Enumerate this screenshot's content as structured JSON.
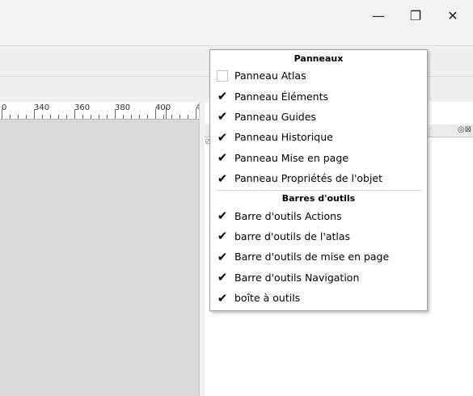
{
  "window": {
    "controls": {
      "minimize": "—",
      "maximize": "❐",
      "close": "✕"
    }
  },
  "ruler": {
    "labels": [
      "0",
      "340",
      "360",
      "380",
      "400",
      "4"
    ]
  },
  "dock": {
    "tab_icons": "◎⊠",
    "fragment": "⊘"
  },
  "menu": {
    "sections": [
      {
        "header": "Panneaux",
        "items": [
          {
            "label": "Panneau Atlas",
            "checked": false
          },
          {
            "label": "Panneau Éléments",
            "checked": true
          },
          {
            "label": "Panneau Guides",
            "checked": true
          },
          {
            "label": "Panneau Historique",
            "checked": true
          },
          {
            "label": "Panneau Mise en page",
            "checked": true
          },
          {
            "label": "Panneau Propriétés de l'objet",
            "checked": true
          }
        ]
      },
      {
        "header": "Barres d'outils",
        "items": [
          {
            "label": "Barre d'outils Actions",
            "checked": true
          },
          {
            "label": "barre d'outils de l'atlas",
            "checked": true
          },
          {
            "label": "Barre d'outils de mise en page",
            "checked": true
          },
          {
            "label": "Barre d'outils Navigation",
            "checked": true
          },
          {
            "label": "boîte à outils",
            "checked": true
          }
        ]
      }
    ],
    "check_glyph": "✔"
  },
  "colors": {
    "canvas": "#d9d9d9",
    "ruler_marker": "#e03030",
    "menu_border": "#a0a0a0"
  }
}
